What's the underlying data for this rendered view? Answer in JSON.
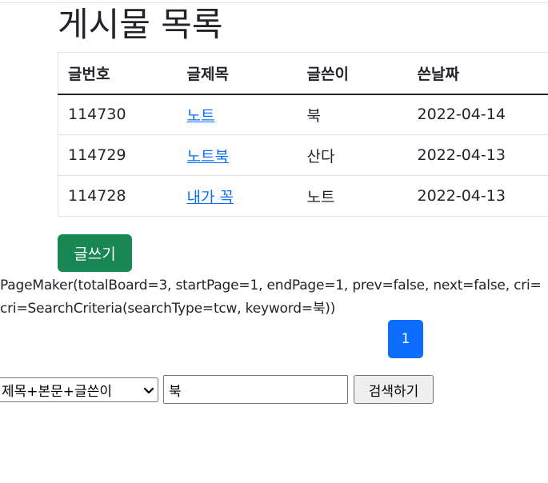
{
  "page": {
    "title": "게시물 목록"
  },
  "table": {
    "headers": [
      "글번호",
      "글제목",
      "글쓴이",
      "쓴날짜"
    ],
    "rows": [
      {
        "no": "114730",
        "title": "노트",
        "writer": "북",
        "date": "2022-04-14"
      },
      {
        "no": "114729",
        "title": "노트북",
        "writer": "산다",
        "date": "2022-04-13"
      },
      {
        "no": "114728",
        "title": "내가 꼭",
        "writer": "노트",
        "date": "2022-04-13"
      }
    ]
  },
  "actions": {
    "write_label": "글쓰기"
  },
  "debug": {
    "page_maker": "PageMaker(totalBoard=3, startPage=1, endPage=1, prev=false, next=false, cri=",
    "criteria": "cri=SearchCriteria(searchType=tcw, keyword=북))"
  },
  "pagination": {
    "current_page": "1"
  },
  "search": {
    "type_selected": "제목+본문+글쓴이",
    "keyword_value": "북",
    "submit_label": "검색하기"
  },
  "colors": {
    "write_button": "#198754",
    "page_active": "#0d6efd",
    "link": "#0d6efd"
  }
}
